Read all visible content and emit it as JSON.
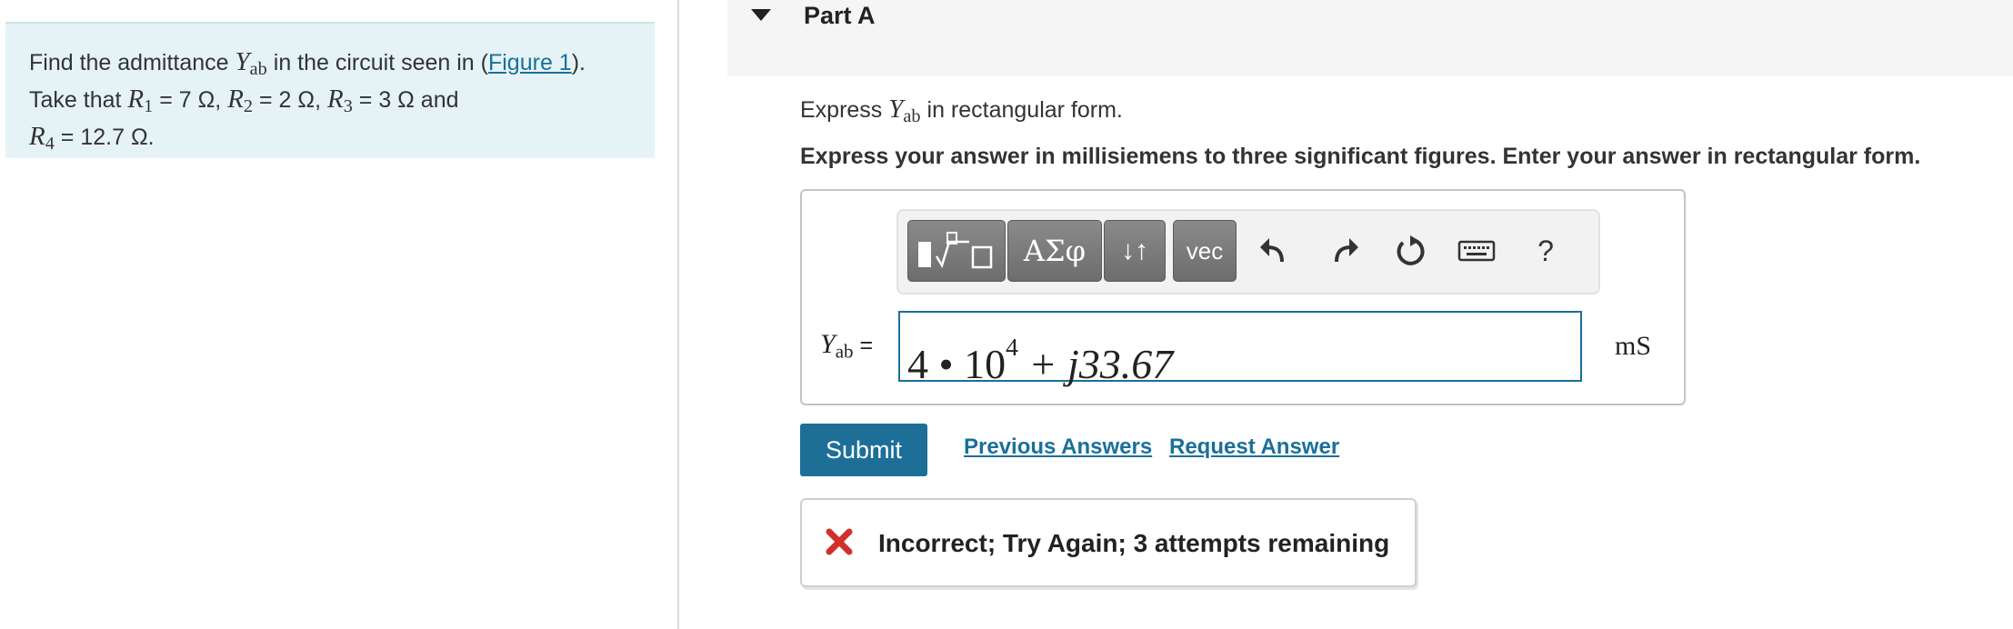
{
  "problem": {
    "intro": "Find the admittance ",
    "y_symbol": "Y",
    "y_sub": "ab",
    "text_after_y": " in the circuit seen in (",
    "figure_link": "Figure 1",
    "text_after_link": ").",
    "take_that": "Take that ",
    "r1_sym": "R",
    "r1_sub": "1",
    "r1_val": " = 7 Ω, ",
    "r2_sym": "R",
    "r2_sub": "2",
    "r2_val": " = 2 Ω, ",
    "r3_sym": "R",
    "r3_sub": "3",
    "r3_val": " = 3 Ω",
    "and": " and",
    "r4_sym": "R",
    "r4_sub": "4",
    "r4_val": " = 12.7 Ω."
  },
  "part": {
    "title": "Part A"
  },
  "instruction": {
    "prefix": "Express ",
    "y_symbol": "Y",
    "y_sub": "ab",
    "suffix": " in rectangular form.",
    "bold": "Express your answer in millisiemens to three significant figures. Enter your answer in rectangular form."
  },
  "toolbar": {
    "greek_label": "ΑΣφ",
    "arrows_label": "↓↑",
    "vec_label": "vec",
    "help_label": "?"
  },
  "answer": {
    "label_symbol": "Y",
    "label_sub": "ab",
    "label_eq": " =",
    "value_base": "4 • 10",
    "value_exp": "4",
    "value_rest": " + j33.67",
    "unit": "mS"
  },
  "actions": {
    "submit_label": "Submit",
    "previous_answers": "Previous Answers",
    "request_answer": "Request Answer"
  },
  "feedback": {
    "message": "Incorrect; Try Again; 3 attempts remaining",
    "status_color": "#d0312d"
  },
  "colors": {
    "accent": "#1d6f98",
    "panel_bg": "#e6f3f6"
  }
}
